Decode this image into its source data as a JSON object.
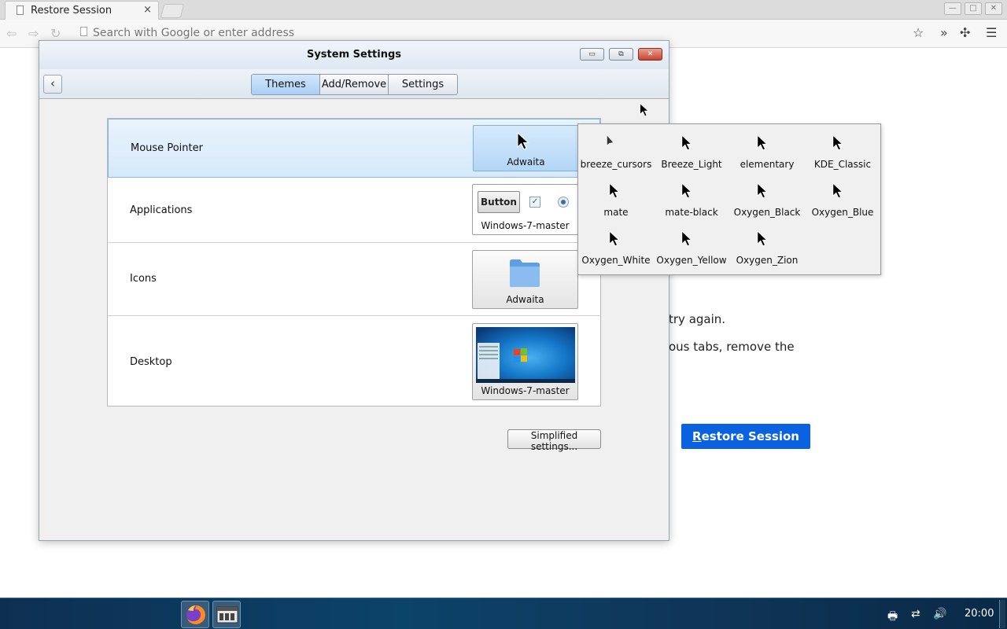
{
  "browser": {
    "tab_title": "Restore Session",
    "tab_close": "×",
    "url_placeholder": "Search with Google or enter address",
    "win_minimize": "—",
    "win_maximize": "□",
    "win_close": "✕"
  },
  "page": {
    "text_line1": "try again.",
    "text_line2": "ous tabs, remove the",
    "restore_button_first": "R",
    "restore_button_rest": "estore Session"
  },
  "dialog": {
    "title": "System Settings",
    "tabs": [
      {
        "label": "Themes",
        "active": true
      },
      {
        "label": "Add/Remove",
        "active": false
      },
      {
        "label": "Settings",
        "active": false
      }
    ],
    "rows": [
      {
        "label": "Mouse Pointer",
        "theme": "Adwaita"
      },
      {
        "label": "Applications",
        "theme": "Windows-7-master",
        "preview_button": "Button"
      },
      {
        "label": "Icons",
        "theme": "Adwaita"
      },
      {
        "label": "Desktop",
        "theme": "Windows-7-master"
      }
    ],
    "simplified_button": "Simplified settings..."
  },
  "cursor_popup": {
    "items": [
      "breeze_cursors",
      "Breeze_Light",
      "elementary",
      "KDE_Classic",
      "mate",
      "mate-black",
      "Oxygen_Black",
      "Oxygen_Blue",
      "Oxygen_White",
      "Oxygen_Yellow",
      "Oxygen_Zion"
    ]
  },
  "taskbar": {
    "clock": "20:00"
  },
  "colors": {
    "accent": "#0a62e0",
    "selection": "#d6e9fa",
    "taskbar": "#0c4369"
  }
}
